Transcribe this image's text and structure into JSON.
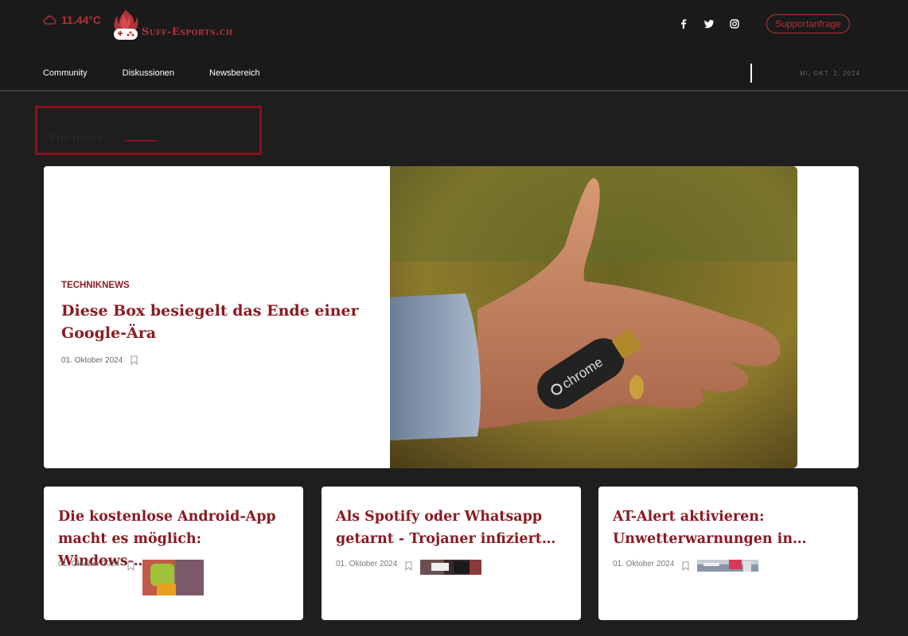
{
  "header": {
    "temperature": "11.44°C",
    "logo_text": "Suff-Esports.ch",
    "social_icons": [
      "facebook-icon",
      "twitter-icon",
      "instagram-icon"
    ],
    "support_button": "Supportanfrage",
    "nav": [
      "Community",
      "Diskussionen",
      "Newsbereich"
    ],
    "date": "MI, OKT. 2, 2024"
  },
  "section": {
    "title": "Für mehr"
  },
  "hero": {
    "category": "TECHNIKNEWS",
    "title": "Diese Box besiegelt das Ende einer Google-Ära",
    "date": "01. Oktober 2024",
    "image_text": "chrome"
  },
  "cards": [
    {
      "title": "Die kostenlose Android-App macht es möglich: Windows-…",
      "date": "01. Oktober 2024"
    },
    {
      "title": "Als Spotify oder Whatsapp getarnt - Trojaner infiziert…",
      "date": "01. Oktober 2024"
    },
    {
      "title": "AT-Alert aktivieren: Unwetterwarnungen in…",
      "date": "01. Oktober 2024"
    }
  ],
  "colors": {
    "accent": "#8b1a22",
    "brand": "#b0333a",
    "background": "#1e1e1e"
  }
}
